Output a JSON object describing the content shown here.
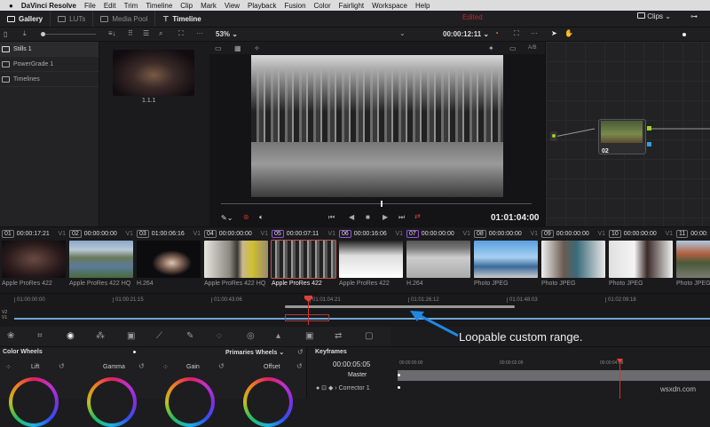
{
  "menubar": {
    "app": "DaVinci Resolve",
    "items": [
      "File",
      "Edit",
      "Trim",
      "Timeline",
      "Clip",
      "Mark",
      "View",
      "Playback",
      "Fusion",
      "Color",
      "Fairlight",
      "Workspace",
      "Help"
    ]
  },
  "tabs": {
    "gallery": "Gallery",
    "luts": "LUTs",
    "media_pool": "Media Pool",
    "timeline": "Timeline"
  },
  "status": "Edited",
  "clips_button": "Clips",
  "toolbar": {
    "zoom": "53%",
    "timecode": "00:00:12:11",
    "ab": "A/B"
  },
  "sidebar": {
    "items": [
      "Stills 1",
      "PowerGrade 1",
      "Timelines"
    ]
  },
  "gallery": {
    "still_label": "1.1.1"
  },
  "viewer": {
    "timecode": "01:01:04:00"
  },
  "node": {
    "label": "02"
  },
  "accent": "#d8322e",
  "clips": [
    {
      "num": "01",
      "tc": "00:00:17:21",
      "track": "V1",
      "codec": "Apple ProRes 422"
    },
    {
      "num": "02",
      "tc": "00:00:00:00",
      "track": "V1",
      "codec": "Apple ProRes 422 HQ"
    },
    {
      "num": "03",
      "tc": "01:00:06:16",
      "track": "V1",
      "codec": "H.264"
    },
    {
      "num": "04",
      "tc": "00:00:00:00",
      "track": "V1",
      "codec": "Apple ProRes 422 HQ"
    },
    {
      "num": "05",
      "tc": "00:00:07:11",
      "track": "V1",
      "codec": "Apple ProRes 422"
    },
    {
      "num": "06",
      "tc": "00:00:16:06",
      "track": "V1",
      "codec": "Apple ProRes 422"
    },
    {
      "num": "07",
      "tc": "00:00:00:00",
      "track": "V1",
      "codec": "H.264"
    },
    {
      "num": "08",
      "tc": "00:00:00:00",
      "track": "V1",
      "codec": "Photo JPEG"
    },
    {
      "num": "09",
      "tc": "00:00:00:00",
      "track": "V1",
      "codec": "Photo JPEG"
    },
    {
      "num": "10",
      "tc": "00:00:00:00",
      "track": "V1",
      "codec": "Photo JPEG"
    },
    {
      "num": "11",
      "tc": "00:00:",
      "track": "V1",
      "codec": "Photo JPEG"
    }
  ],
  "mini_timeline": {
    "ruler": [
      "01:00:00:00",
      "01:00:21:15",
      "01:00:43:06",
      "01:01:04:21",
      "01:01:26:12",
      "01:01:48:03",
      "01:02:09:18"
    ],
    "tracks": [
      "V2",
      "V1"
    ]
  },
  "annotation": "Loopable custom range.",
  "color_wheels": {
    "title": "Color Wheels",
    "mode": "Primaries Wheels",
    "wheels": [
      "Lift",
      "Gamma",
      "Gain",
      "Offset"
    ]
  },
  "keyframes": {
    "title": "Keyframes",
    "timecode": "00:00:05:05",
    "ruler": [
      "00:00:00:00",
      "00:00:02:09",
      "00:00:04:18"
    ],
    "rows": [
      "Master",
      "Corrector 1"
    ]
  },
  "watermark": "wsxdn.com"
}
